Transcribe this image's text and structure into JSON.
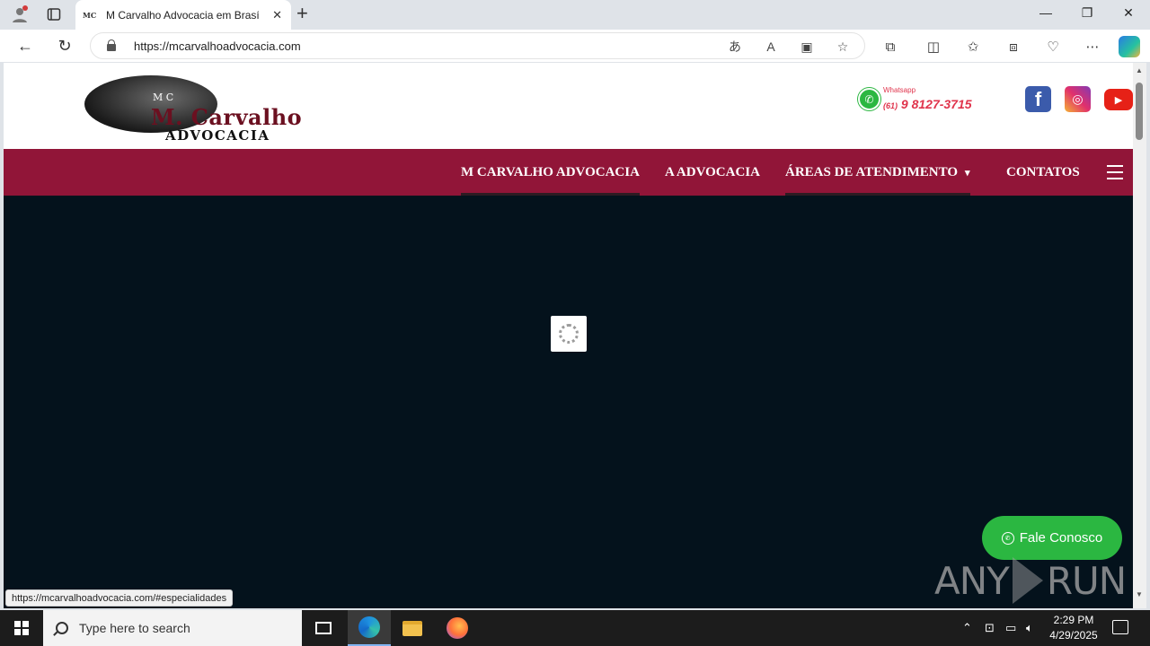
{
  "browser": {
    "tab_favicon": "MC",
    "tab_title": "M Carvalho Advocacia em Brasília",
    "url": "https://mcarvalhoadvocacia.com",
    "status_url": "https://mcarvalhoadvocacia.com/#especialidades"
  },
  "site": {
    "logo": {
      "monogram": "M C",
      "title": "M. Carvalho",
      "subtitle": "ADVOCACIA"
    },
    "whatsapp": {
      "label": "Whatsapp",
      "area_code": "(61)",
      "number": "9 8127-3715"
    },
    "nav": [
      {
        "label": "M CARVALHO ADVOCACIA",
        "active": true
      },
      {
        "label": "A ADVOCACIA",
        "active": false
      },
      {
        "label": "ÁREAS DE ATENDIMENTO",
        "active": true,
        "dropdown": true
      },
      {
        "label": "CONTATOS",
        "active": false
      }
    ],
    "fab_label": "Fale Conosco"
  },
  "watermark": {
    "left": "ANY",
    "right": "RUN"
  },
  "taskbar": {
    "search_placeholder": "Type here to search",
    "time": "2:29 PM",
    "date": "4/29/2025"
  },
  "colors": {
    "nav_bg": "#911538",
    "hero_bg": "#04121c",
    "whatsapp_green": "#2bb741",
    "accent_red": "#e0344c"
  },
  "icons": {
    "tab_actions": [
      "profile-icon",
      "tab-actions-icon"
    ],
    "toolbar": [
      "back-icon",
      "refresh-icon",
      "translate-icon",
      "read-aloud-icon",
      "immersive-reader-icon",
      "favorite-icon",
      "extensions-icon",
      "split-screen-icon",
      "favorites-icon",
      "collections-icon",
      "browser-essentials-icon",
      "more-icon",
      "copilot-icon"
    ],
    "social": [
      "facebook-icon",
      "instagram-icon",
      "youtube-icon"
    ]
  }
}
